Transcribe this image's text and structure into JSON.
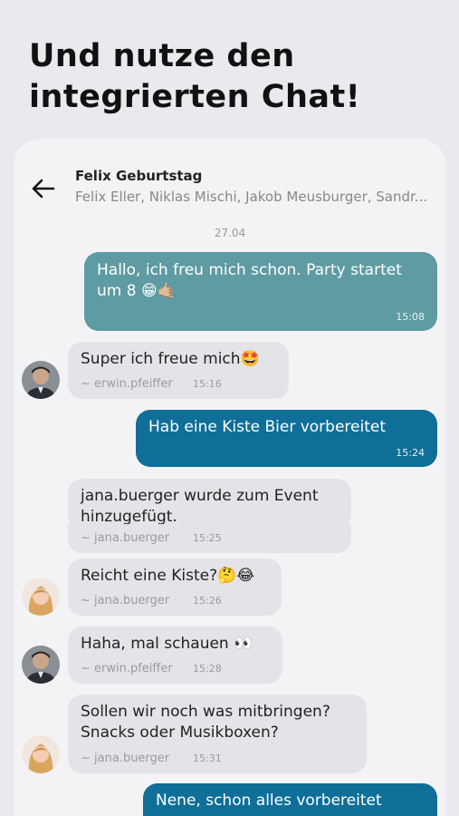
{
  "headline": {
    "line1": "Und nutze den",
    "line2": "integrierten Chat!"
  },
  "chat": {
    "title": "Felix Geburtstag",
    "members": "Felix Eller, Niklas Mischi, Jakob Meusburger, Sandr...",
    "date": "27.04"
  },
  "messages": [
    {
      "text_line1": "Hallo, ich freu mich schon. Party startet",
      "text_line2": "um 8 😁🤙🏼",
      "time": "15:08"
    },
    {
      "text": "Super ich freue mich🤩",
      "author": "~ erwin.pfeiffer",
      "time": "15:16"
    },
    {
      "text": "Hab eine Kiste Bier vorbereitet",
      "time": "15:24"
    },
    {
      "text_line1": "jana.buerger wurde zum Event",
      "text_line2": "hinzugefügt.",
      "author": "~ jana.buerger",
      "time": "15:25"
    },
    {
      "text": "Reicht eine Kiste?🤔😂",
      "author": "~ jana.buerger",
      "time": "15:26"
    },
    {
      "text": "Haha, mal schauen 👀",
      "author": "~ erwin.pfeiffer",
      "time": "15:28"
    },
    {
      "text_line1": "Sollen wir noch was mitbringen?",
      "text_line2": "Snacks oder Musikboxen?",
      "author": "~ jana.buerger",
      "time": "15:31"
    },
    {
      "text": "Nene, schon alles vorbereitet"
    }
  ],
  "icons": {
    "back": "arrow-left-icon",
    "avatar_male": "avatar-male",
    "avatar_female": "avatar-female"
  },
  "colors": {
    "bubble_light": "#5e9ba3",
    "bubble_dark": "#0f6f98",
    "bubble_other": "#e4e4e8"
  }
}
